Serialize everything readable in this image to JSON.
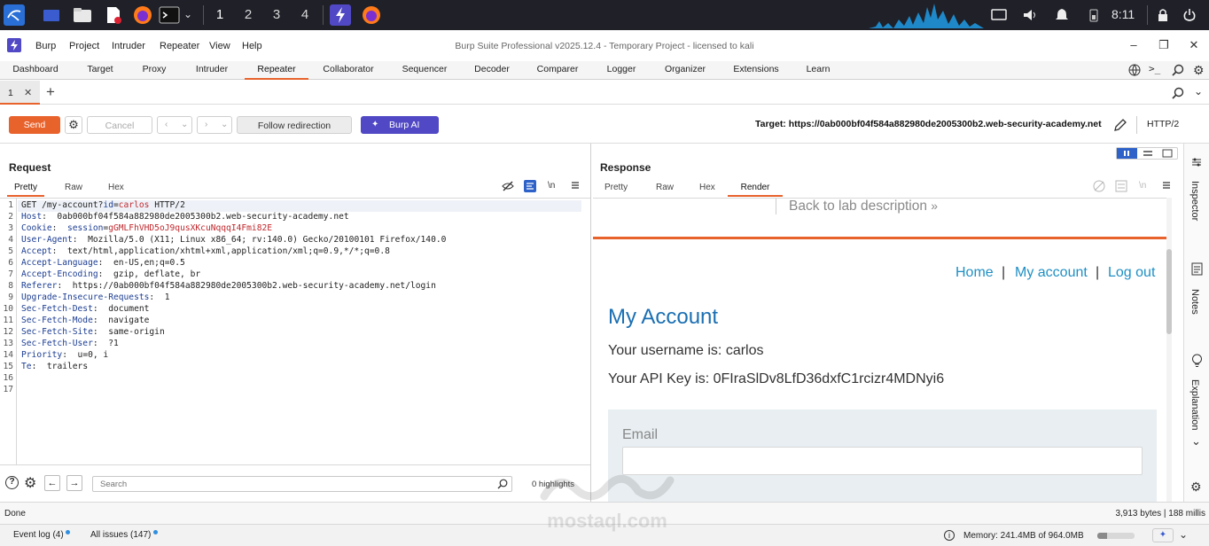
{
  "taskbar": {
    "workspaces": [
      "1",
      "2",
      "3",
      "4"
    ],
    "clock": "8:11"
  },
  "window": {
    "title": "Burp Suite Professional v2025.12.4 - Temporary Project - licensed to kali",
    "menu": [
      "Burp",
      "Project",
      "Intruder",
      "Repeater",
      "View",
      "Help"
    ]
  },
  "main_tabs": [
    "Dashboard",
    "Target",
    "Proxy",
    "Intruder",
    "Repeater",
    "Collaborator",
    "Sequencer",
    "Decoder",
    "Comparer",
    "Logger",
    "Organizer",
    "Extensions",
    "Learn"
  ],
  "repeater": {
    "tab_label": "1",
    "send_label": "Send",
    "cancel_label": "Cancel",
    "follow_label": "Follow redirection",
    "ai_label": "Burp AI",
    "target": "Target: https://0ab000bf04f584a882980de2005300b2.web-security-academy.net",
    "http_version": "HTTP/2"
  },
  "request": {
    "title": "Request",
    "view_tabs": [
      "Pretty",
      "Raw",
      "Hex"
    ],
    "lines": [
      {
        "n": "1",
        "parts": [
          {
            "t": "GET /my-account?",
            "c": ""
          },
          {
            "t": "id",
            "c": "hdr"
          },
          {
            "t": "=",
            "c": ""
          },
          {
            "t": "carlos",
            "c": "val-red"
          },
          {
            "t": " HTTP/2",
            "c": ""
          }
        ]
      },
      {
        "n": "2",
        "parts": [
          {
            "t": "Host",
            "c": "hdr"
          },
          {
            "t": ":  0ab000bf04f584a882980de2005300b2.web-security-academy.net",
            "c": ""
          }
        ]
      },
      {
        "n": "3",
        "parts": [
          {
            "t": "Cookie",
            "c": "hdr"
          },
          {
            "t": ":  ",
            "c": ""
          },
          {
            "t": "session",
            "c": "hdr"
          },
          {
            "t": "=",
            "c": ""
          },
          {
            "t": "gGMLFhVHD5oJ9qusXKcuNqqqI4Fmi82E",
            "c": "val-red"
          }
        ]
      },
      {
        "n": "4",
        "parts": [
          {
            "t": "User-Agent",
            "c": "hdr"
          },
          {
            "t": ":  Mozilla/5.0 (X11; Linux x86_64; rv:140.0) Gecko/20100101 Firefox/140.0",
            "c": ""
          }
        ]
      },
      {
        "n": "5",
        "parts": [
          {
            "t": "Accept",
            "c": "hdr"
          },
          {
            "t": ":  text/html,application/xhtml+xml,application/xml;q=0.9,*/*;q=0.8",
            "c": ""
          }
        ]
      },
      {
        "n": "6",
        "parts": [
          {
            "t": "Accept-Language",
            "c": "hdr"
          },
          {
            "t": ":  en-US,en;q=0.5",
            "c": ""
          }
        ]
      },
      {
        "n": "7",
        "parts": [
          {
            "t": "Accept-Encoding",
            "c": "hdr"
          },
          {
            "t": ":  gzip, deflate, br",
            "c": ""
          }
        ]
      },
      {
        "n": "8",
        "parts": [
          {
            "t": "Referer",
            "c": "hdr"
          },
          {
            "t": ":  https://0ab000bf04f584a882980de2005300b2.web-security-academy.net/login",
            "c": ""
          }
        ]
      },
      {
        "n": "9",
        "parts": [
          {
            "t": "Upgrade-Insecure-Requests",
            "c": "hdr"
          },
          {
            "t": ":  1",
            "c": ""
          }
        ]
      },
      {
        "n": "10",
        "parts": [
          {
            "t": "Sec-Fetch-Dest",
            "c": "hdr"
          },
          {
            "t": ":  document",
            "c": ""
          }
        ]
      },
      {
        "n": "11",
        "parts": [
          {
            "t": "Sec-Fetch-Mode",
            "c": "hdr"
          },
          {
            "t": ":  navigate",
            "c": ""
          }
        ]
      },
      {
        "n": "12",
        "parts": [
          {
            "t": "Sec-Fetch-Site",
            "c": "hdr"
          },
          {
            "t": ":  same-origin",
            "c": ""
          }
        ]
      },
      {
        "n": "13",
        "parts": [
          {
            "t": "Sec-Fetch-User",
            "c": "hdr"
          },
          {
            "t": ":  ?1",
            "c": ""
          }
        ]
      },
      {
        "n": "14",
        "parts": [
          {
            "t": "Priority",
            "c": "hdr"
          },
          {
            "t": ":  u=0, i",
            "c": ""
          }
        ]
      },
      {
        "n": "15",
        "parts": [
          {
            "t": "Te",
            "c": "hdr"
          },
          {
            "t": ":  trailers",
            "c": ""
          }
        ]
      },
      {
        "n": "16",
        "parts": []
      },
      {
        "n": "17",
        "parts": []
      }
    ],
    "search_placeholder": "Search",
    "highlights": "0 highlights"
  },
  "response": {
    "title": "Response",
    "view_tabs": [
      "Pretty",
      "Raw",
      "Hex",
      "Render"
    ],
    "render": {
      "back_link": "Back to lab description",
      "nav_home": "Home",
      "nav_sep": "|",
      "nav_account": "My account",
      "nav_logout": "Log out",
      "heading": "My Account",
      "username_line": "Your username is: carlos",
      "apikey_line": "Your API Key is: 0FIraSlDv8LfD36dxfC1rcizr4MDNyi6",
      "email_label": "Email"
    }
  },
  "sidebar": [
    "Inspector",
    "Notes",
    "Explanation"
  ],
  "status": {
    "left": "Done",
    "right": "3,913 bytes | 188 millis"
  },
  "bottom": {
    "event_log": "Event log (4)",
    "all_issues": "All issues (147)",
    "memory": "Memory: 241.4MB of 964.0MB",
    "memory_fraction": 0.25
  },
  "watermark": {
    "text": "mostaql.com"
  },
  "colors": {
    "accent": "#e8622c",
    "burp_ai": "#5048c4",
    "header_name": "#1c3d92",
    "param_value": "#c0282d",
    "link": "#1f8fc4",
    "heading": "#1a6fb3"
  }
}
